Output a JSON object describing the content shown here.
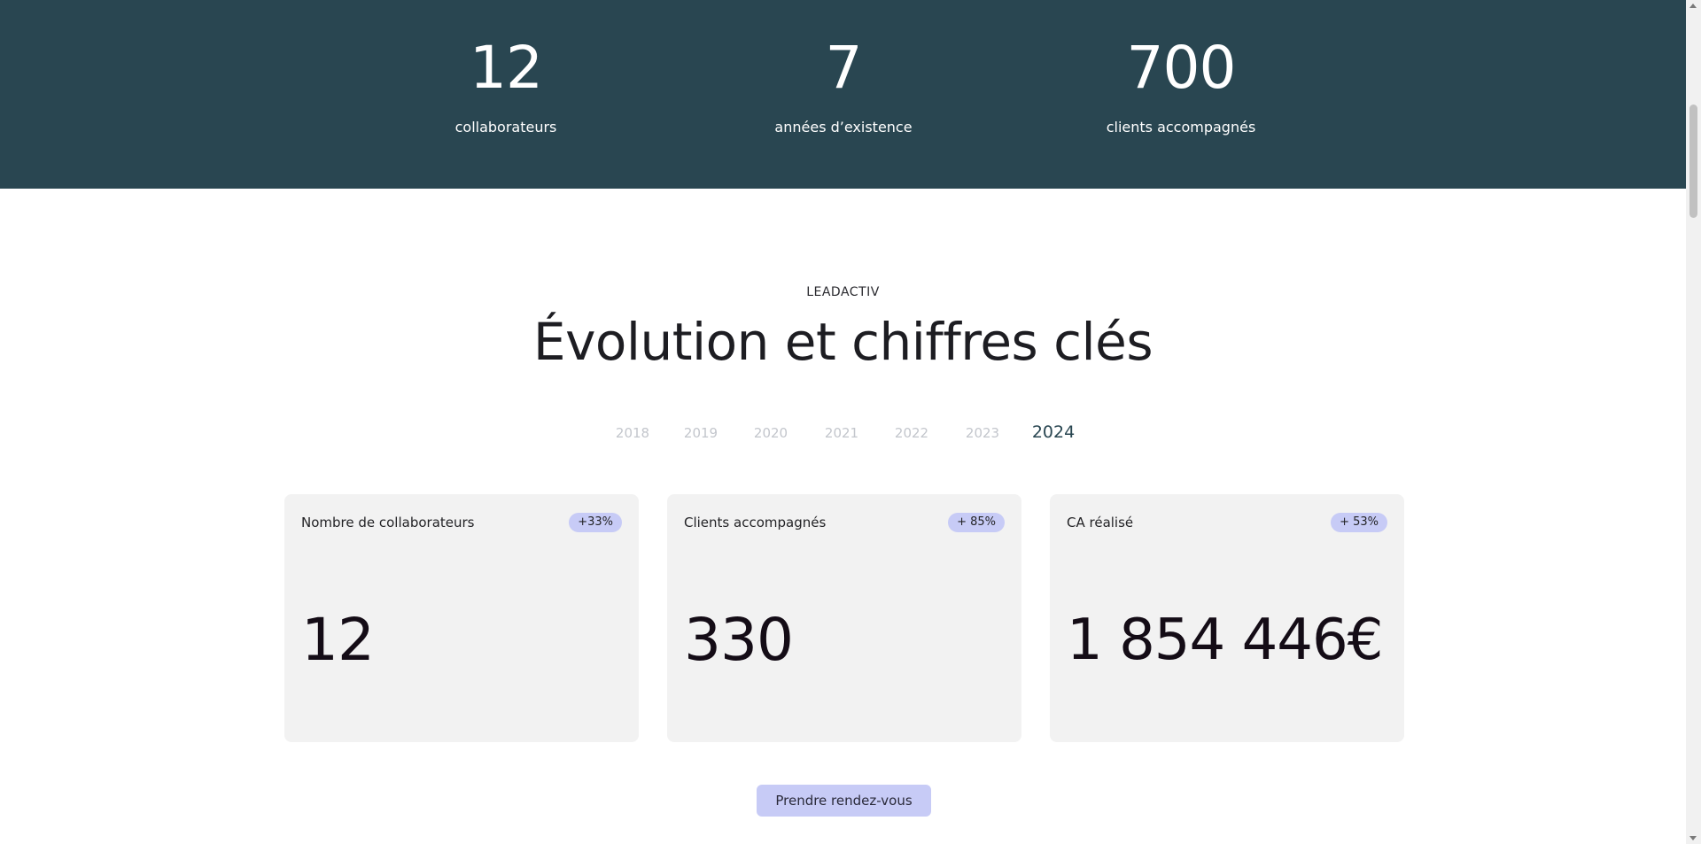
{
  "stats": [
    {
      "value": "12",
      "label": "collaborateurs"
    },
    {
      "value": "7",
      "label": "années d’existence"
    },
    {
      "value": "700",
      "label": "clients accompagnés"
    }
  ],
  "section": {
    "eyebrow": "LEADACTIV",
    "title": "Évolution et chiffres clés"
  },
  "years": {
    "items": [
      "2018",
      "2019",
      "2020",
      "2021",
      "2022",
      "2023",
      "2024"
    ],
    "selected": "2024"
  },
  "cards": [
    {
      "label": "Nombre de collaborateurs",
      "badge": "+33%",
      "value": "12"
    },
    {
      "label": "Clients accompagnés",
      "badge": "+ 85%",
      "value": "330"
    },
    {
      "label": "CA réalisé",
      "badge": "+ 53%",
      "value": "1 854 446€"
    }
  ],
  "cta": {
    "label": "Prendre rendez-vous"
  },
  "colors": {
    "band": "#294651",
    "card_bg": "#f2f2f2",
    "accent": "#c7cbf6",
    "year_inactive": "#c3c6cc",
    "year_active": "#294651"
  }
}
